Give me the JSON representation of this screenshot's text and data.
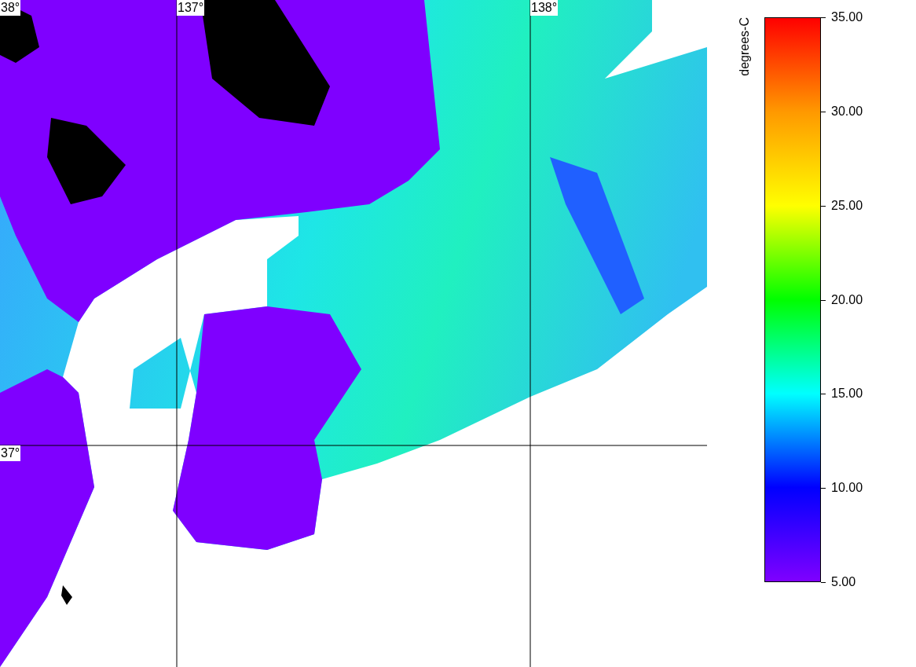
{
  "map": {
    "longitude_labels": [
      "38°",
      "137°",
      "138°"
    ],
    "latitude_labels": [
      "37°"
    ]
  },
  "colorbar": {
    "unit": "degrees-C",
    "ticks": [
      "35.00",
      "30.00",
      "25.00",
      "20.00",
      "15.00",
      "10.00",
      "5.00"
    ]
  }
}
